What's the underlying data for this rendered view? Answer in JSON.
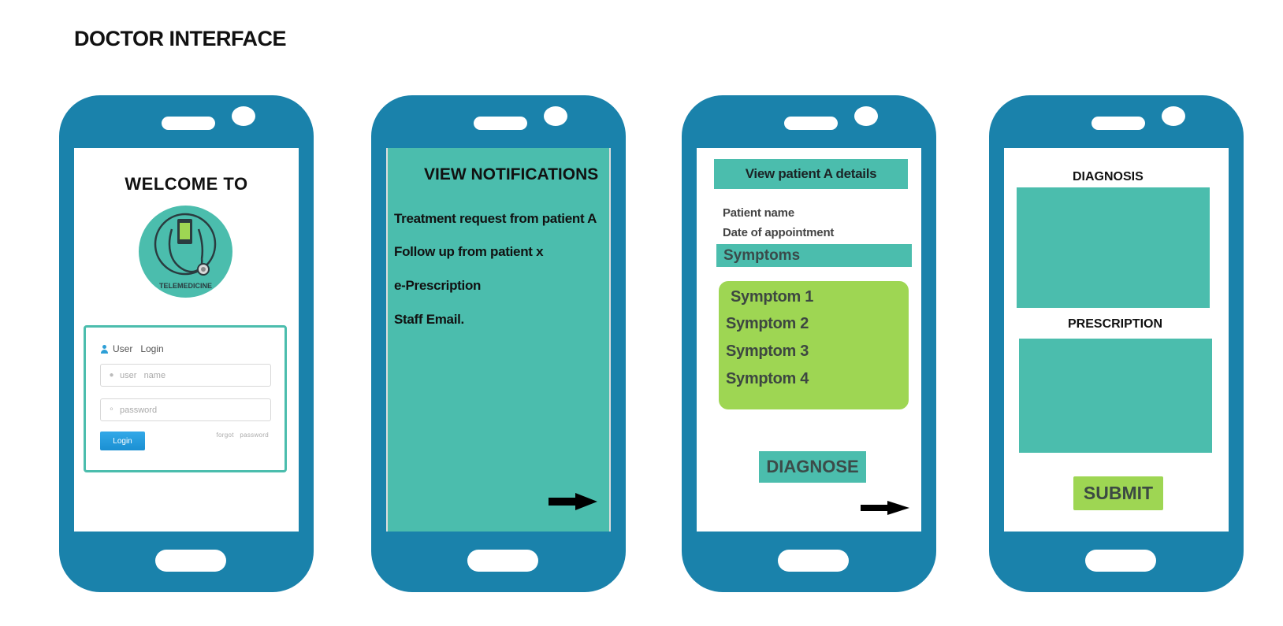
{
  "page_title": "DOCTOR INTERFACE",
  "colors": {
    "phone_body": "#1a82ab",
    "teal": "#4bbdad",
    "green": "#9ed653",
    "login_button": "#1b8fd2"
  },
  "screen1": {
    "welcome": "WELCOME TO",
    "logo_text": "TELEMEDICINE",
    "logo_icon": "stethoscope-phone-icon",
    "login": {
      "header": "User   Login",
      "username_placeholder": "user   name",
      "password_placeholder": "password",
      "button": "Login",
      "forgot": "forgot   password"
    }
  },
  "screen2": {
    "title": "VIEW NOTIFICATIONS",
    "items": [
      "Treatment request from patient A",
      "Follow up from patient x",
      "e-Prescription",
      "Staff Email."
    ],
    "next_icon": "right-arrow-icon"
  },
  "screen3": {
    "header": "View patient A details",
    "patient_name": "Patient name",
    "date": "Date of appointment",
    "symptoms_label": "Symptoms",
    "symptoms": [
      "Symptom 1",
      "Symptom 2",
      "Symptom 3",
      "Symptom 4"
    ],
    "diagnose": "DIAGNOSE",
    "next_icon": "right-arrow-icon"
  },
  "screen4": {
    "diagnosis_label": "DIAGNOSIS",
    "prescription_label": "PRESCRIPTION",
    "submit": "SUBMIT"
  }
}
